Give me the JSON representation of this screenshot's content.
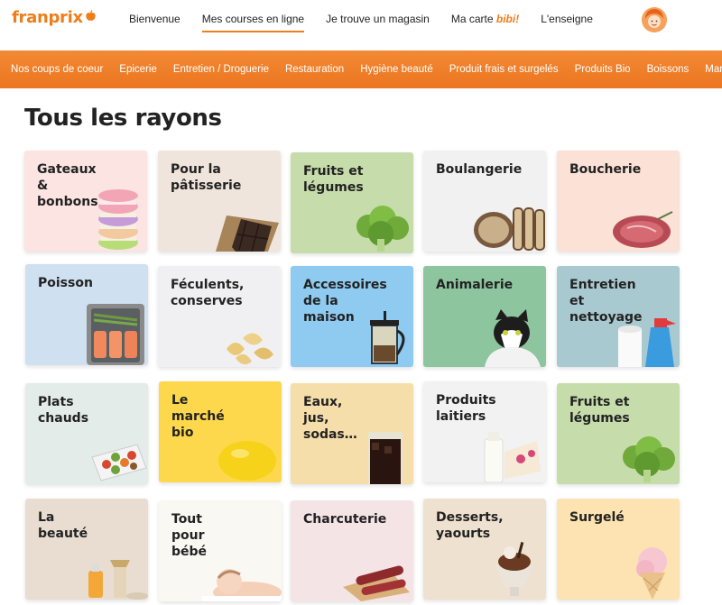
{
  "brand": {
    "logo": "franprix",
    "accent": "#ee7d1a"
  },
  "topnav": [
    {
      "label": "Bienvenue"
    },
    {
      "label": "Mes courses en ligne"
    },
    {
      "label": "Je trouve un magasin"
    },
    {
      "label_prefix": "Ma carte ",
      "label_accent": "bibi!"
    },
    {
      "label": "L'enseigne"
    }
  ],
  "categories": [
    "Nos coups de coeur",
    "Epicerie",
    "Entretien / Droguerie",
    "Restauration",
    "Hygiène beauté",
    "Produit frais et surgelés",
    "Produits Bio",
    "Boissons",
    "Marché frais"
  ],
  "page_title": "Tous les rayons",
  "tiles": [
    {
      "label": "Gateaux\n&\nbonbons",
      "bg": "#fbe4e1",
      "icon": "macarons-icon"
    },
    {
      "label": "Pour la\npâtisserie",
      "bg": "#efe5dc",
      "icon": "chocolate-icon"
    },
    {
      "label": "Fruits et\nlégumes",
      "bg": "#c6dcaa",
      "icon": "broccoli-icon"
    },
    {
      "label": "Boulangerie",
      "bg": "#f1f1f2",
      "icon": "bread-icon"
    },
    {
      "label": "Boucherie",
      "bg": "#fbe1d6",
      "icon": "steak-icon"
    },
    {
      "label": "Poisson",
      "bg": "#cfe0f0",
      "icon": "salmon-tray-icon"
    },
    {
      "label": "Féculents,\nconserves",
      "bg": "#f0f0f2",
      "icon": "pasta-icon"
    },
    {
      "label": "Accessoires\nde la\nmaison",
      "bg": "#8fcaf0",
      "icon": "french-press-icon"
    },
    {
      "label": "Animalerie",
      "bg": "#8dc59f",
      "icon": "cat-icon"
    },
    {
      "label": "Entretien\net\nnettoyage",
      "bg": "#a9c9d1",
      "icon": "spray-bottle-icon"
    },
    {
      "label": "Plats\nchauds",
      "bg": "#e4ecea",
      "icon": "hot-dish-icon"
    },
    {
      "label": "Le\nmarché\nbio",
      "bg": "#fdd84c",
      "icon": "lemon-icon"
    },
    {
      "label": "Eaux,\njus,\nsodas…",
      "bg": "#f5deaa",
      "icon": "soda-glass-icon"
    },
    {
      "label": "Produits\nlaitiers",
      "bg": "#f2f2f3",
      "icon": "dairy-icon"
    },
    {
      "label": "Fruits et\nlégumes",
      "bg": "#c6dcaa",
      "icon": "broccoli-icon"
    },
    {
      "label": "La\nbeauté",
      "bg": "#e9ddd1",
      "icon": "beauty-products-icon"
    },
    {
      "label": "Tout\npour\nbébé",
      "bg": "#faf8f3",
      "icon": "baby-icon"
    },
    {
      "label": "Charcuterie",
      "bg": "#f4e4e6",
      "icon": "sausage-icon"
    },
    {
      "label": "Desserts,\nyaourts",
      "bg": "#efe1cf",
      "icon": "sundae-icon"
    },
    {
      "label": "Surgelé",
      "bg": "#fde3b1",
      "icon": "ice-cream-icon"
    }
  ]
}
